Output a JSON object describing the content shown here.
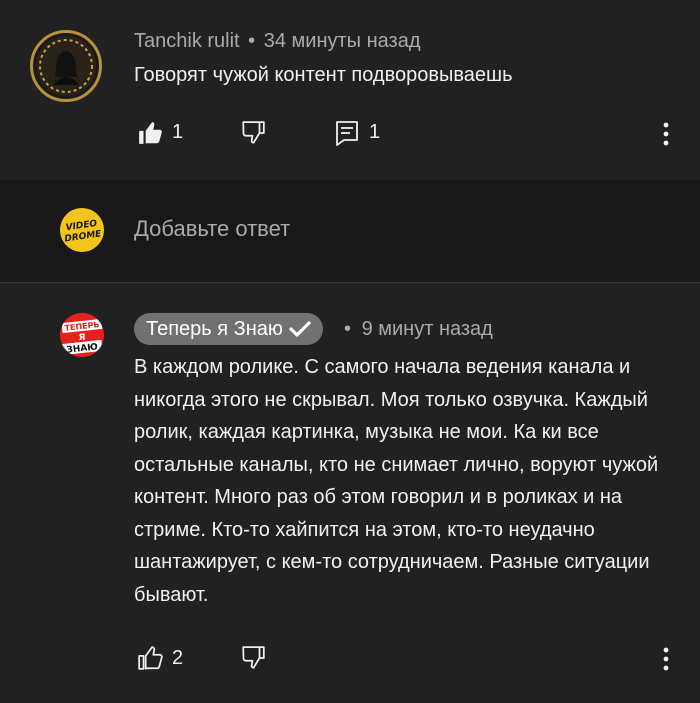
{
  "comment1": {
    "author": "Tanchik rulit",
    "separator": "•",
    "time": "34 минуты назад",
    "text": "Говорят чужой контент подворовываешь",
    "likes": "1",
    "replies": "1"
  },
  "reply_box": {
    "placeholder": "Добавьте ответ",
    "avatar_text_line1": "VIDEO",
    "avatar_text_line2": "DROME"
  },
  "comment2": {
    "author": "Теперь я Знаю",
    "separator": "•",
    "time": "9 минут назад",
    "text": "В каждом ролике. С самого начала ведения канала и никогда этого не скрывал. Моя только озвучка. Каждый ролик, каждая картинка, музыка не мои. Ка ки все остальные каналы, кто не снимает лично, воруют чужой контент. Много раз об этом говорил и в роликах и на стриме. Кто-то хайпится на этом, кто-то неудачно шантажирует, с кем-то сотрудничаем. Разные ситуации бывают.",
    "likes": "2",
    "avatar_text_line1": "ТЕПЕРЬ",
    "avatar_text_line2": "Я",
    "avatar_text_line3": "ЗНАЮ"
  }
}
